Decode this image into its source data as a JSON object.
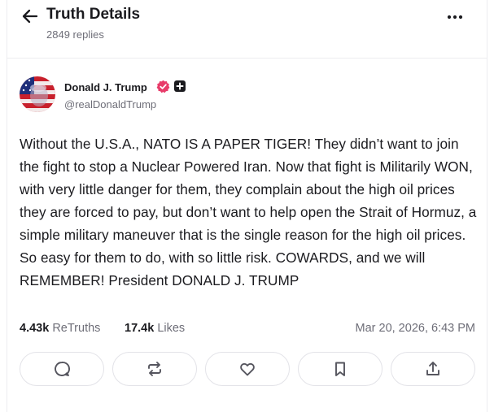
{
  "header": {
    "title": "Truth Details",
    "replies": "2849 replies",
    "back_icon": "arrow-left-icon",
    "more_icon": "more-horizontal-icon"
  },
  "author": {
    "display_name": "Donald J. Trump",
    "handle": "@realDonaldTrump",
    "verified_color": "#e83c6a",
    "badge_icon": "plus-badge-icon"
  },
  "post": {
    "text": "Without the U.S.A., NATO IS A PAPER TIGER! They didn’t want to join the fight to stop a Nuclear Powered Iran. Now that fight is Militarily WON, with very little danger for them, they complain about the high oil prices they are forced to pay, but don’t want to help open the Strait of Hormuz, a simple military maneuver that is the single reason for the high oil prices. So easy for them to do, with so little risk. COWARDS, and we will REMEMBER! President DONALD J. TRUMP"
  },
  "stats": {
    "retruths_count": "4.43k",
    "retruths_label": "ReTruths",
    "likes_count": "17.4k",
    "likes_label": "Likes",
    "timestamp": "Mar 20, 2026, 6:43 PM"
  },
  "actions": [
    {
      "name": "reply",
      "icon": "reply-bubble-icon"
    },
    {
      "name": "retruth",
      "icon": "retruth-icon"
    },
    {
      "name": "like",
      "icon": "heart-icon"
    },
    {
      "name": "bookmark",
      "icon": "bookmark-icon"
    },
    {
      "name": "share",
      "icon": "share-icon"
    }
  ],
  "colors": {
    "text": "#1b1b1f",
    "muted": "#6e6e78",
    "border": "#e3e3e8",
    "icon": "#55555e"
  }
}
